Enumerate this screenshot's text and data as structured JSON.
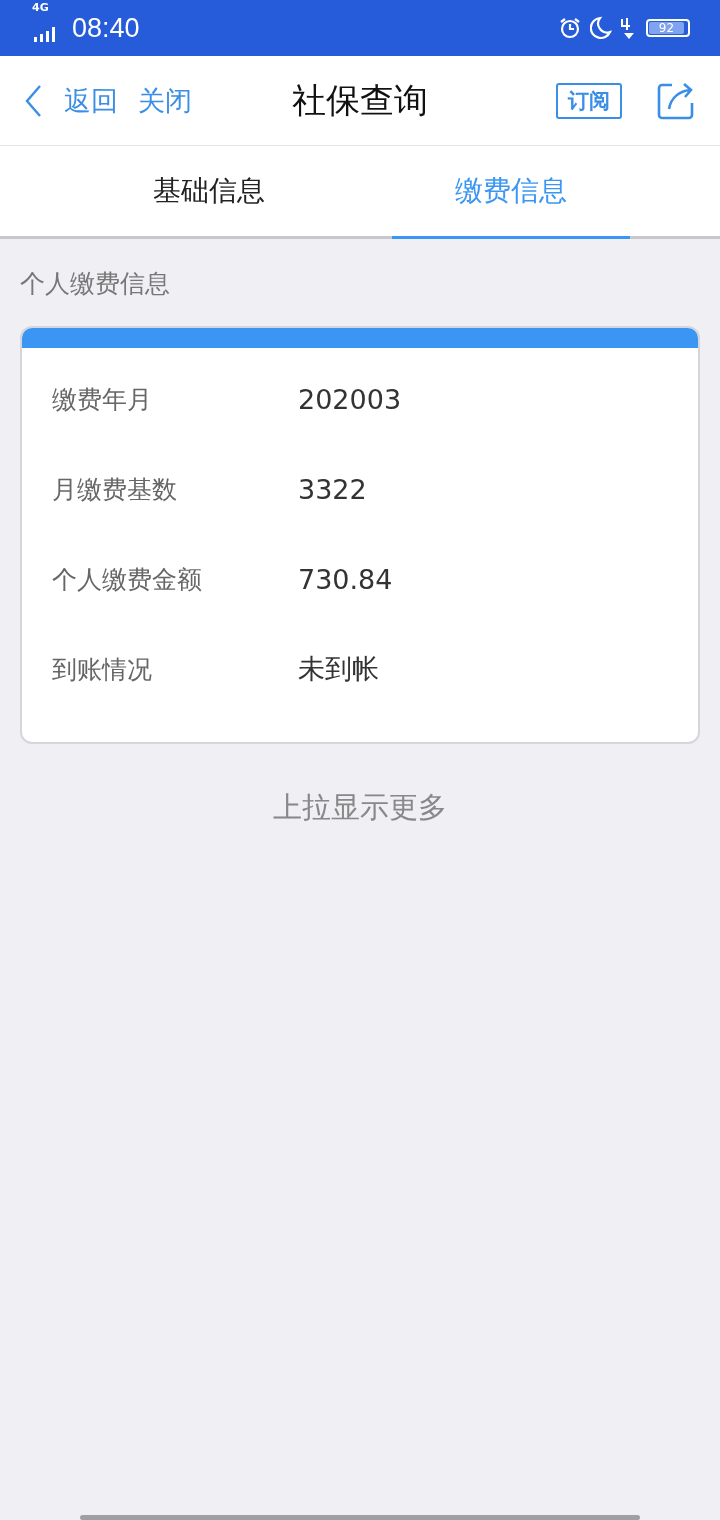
{
  "status_bar": {
    "network": "4G",
    "time": "08:40",
    "battery": "92"
  },
  "header": {
    "back": "返回",
    "close": "关闭",
    "title": "社保查询",
    "subscribe": "订阅"
  },
  "tabs": [
    {
      "label": "基础信息",
      "selected": false
    },
    {
      "label": "缴费信息",
      "selected": true
    }
  ],
  "section_title": "个人缴费信息",
  "card": {
    "rows": [
      {
        "label": "缴费年月",
        "value": "202003"
      },
      {
        "label": "月缴费基数",
        "value": "3322"
      },
      {
        "label": "个人缴费金额",
        "value": "730.84"
      },
      {
        "label": "到账情况",
        "value": "未到帐"
      }
    ]
  },
  "footer": "上拉显示更多"
}
